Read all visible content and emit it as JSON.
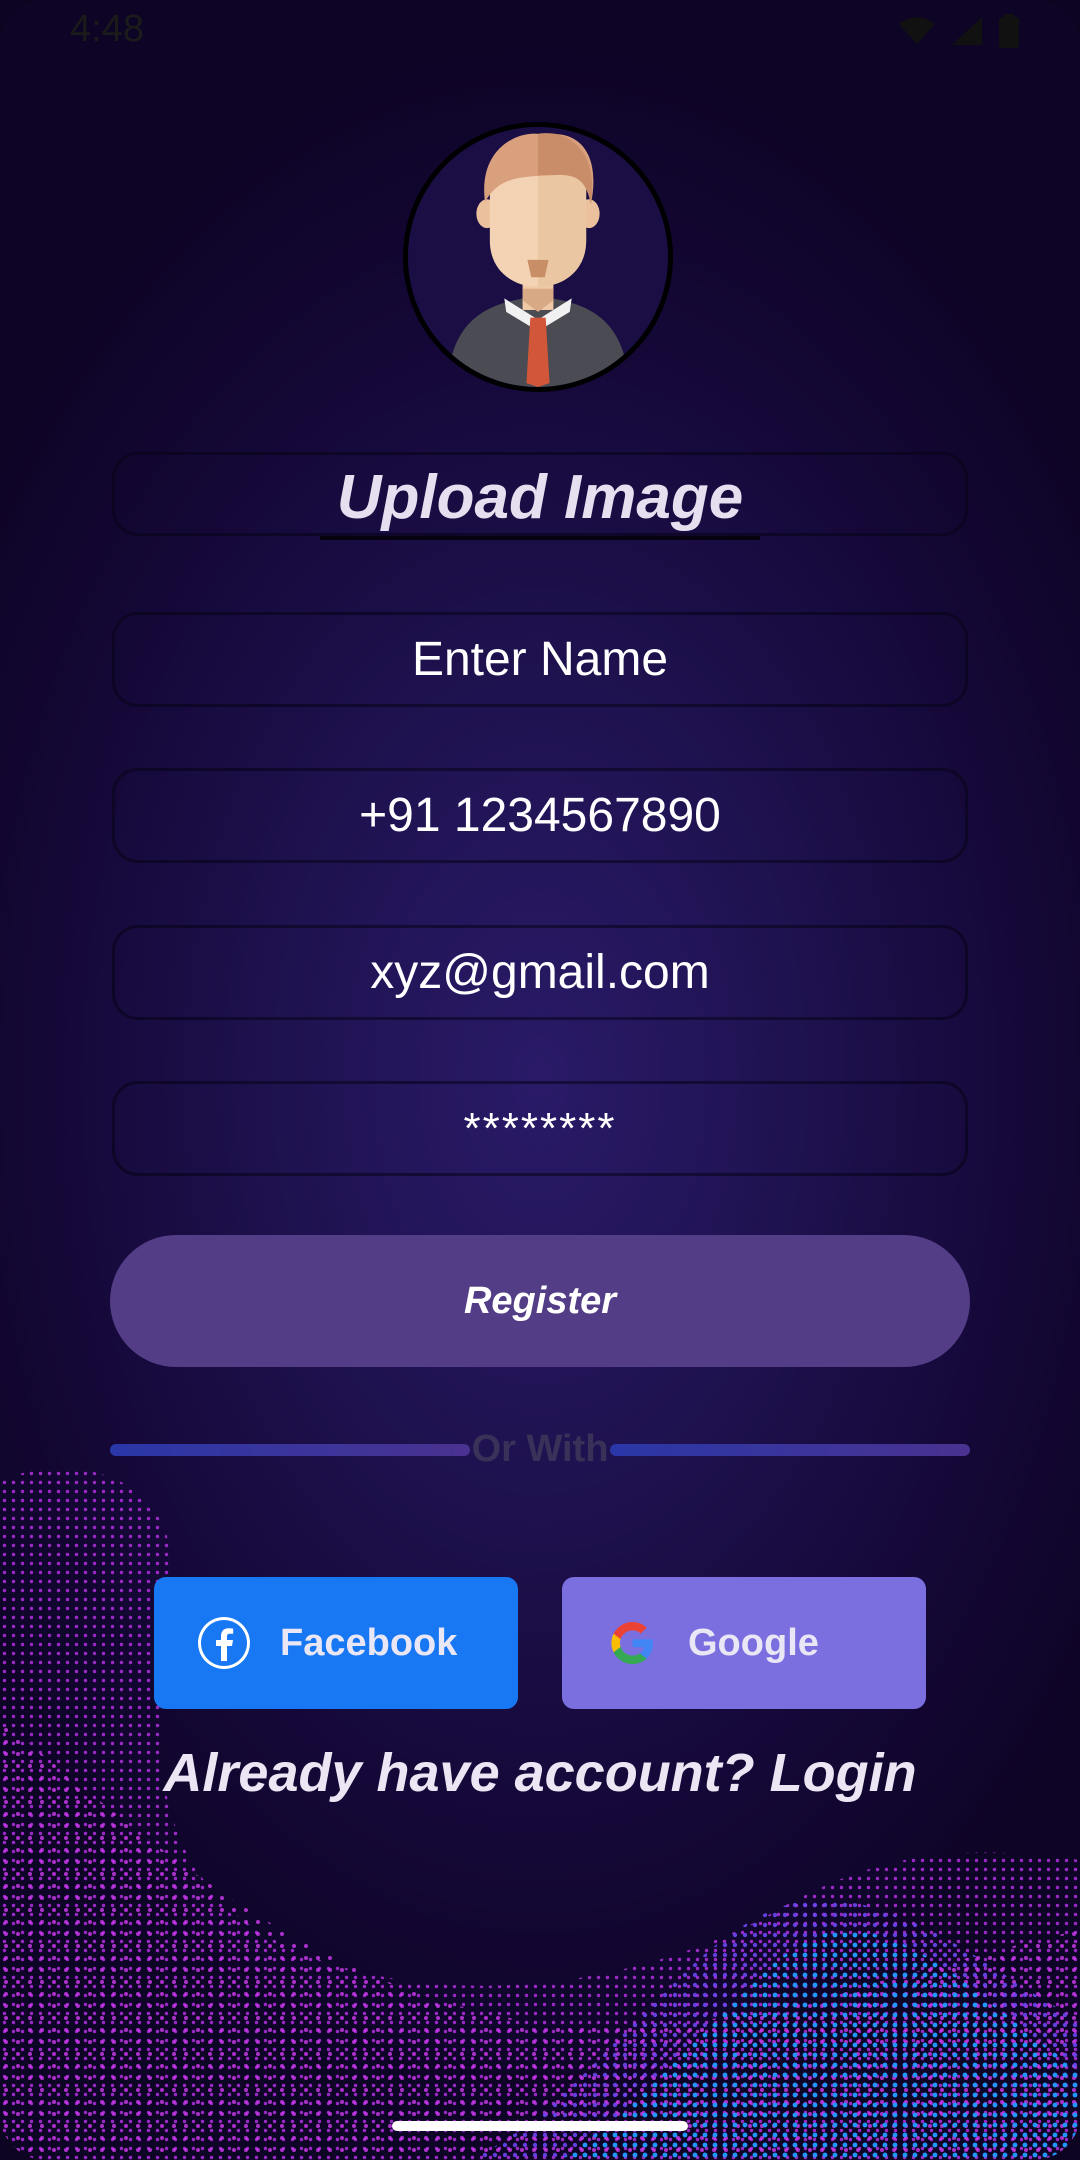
{
  "status_bar": {
    "time": "4:48",
    "icons": [
      "wifi-icon",
      "cellular-signal-icon",
      "battery-icon"
    ]
  },
  "profile": {
    "avatar": "avatar",
    "upload_label": "Upload Image"
  },
  "form": {
    "name_value": "Enter Name",
    "phone_value": "+91 1234567890",
    "email_value": "xyz@gmail.com",
    "password_value": "********"
  },
  "actions": {
    "register_label": "Register",
    "divider_label": "Or With",
    "facebook_label": "Facebook",
    "google_label": "Google",
    "login_prompt": "Already have account? Login"
  },
  "colors": {
    "background": "#1f1250",
    "register_button": "#533d87",
    "facebook": "#1877f2",
    "google": "#7b6fdf",
    "wave_magenta": "#b22fe0",
    "wave_blue": "#1e9bff"
  }
}
